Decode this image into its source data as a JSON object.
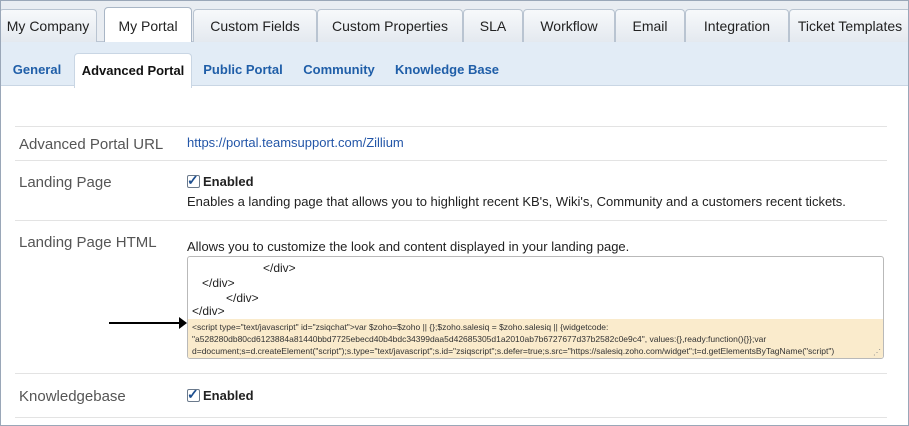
{
  "top_tabs": [
    {
      "label": "My Company"
    },
    {
      "label": "My Portal",
      "active": true
    },
    {
      "label": "Custom Fields"
    },
    {
      "label": "Custom Properties"
    },
    {
      "label": "SLA"
    },
    {
      "label": "Workflow"
    },
    {
      "label": "Email"
    },
    {
      "label": "Integration"
    },
    {
      "label": "Ticket Templates"
    }
  ],
  "sub_tabs": [
    {
      "label": "General"
    },
    {
      "label": "Advanced Portal",
      "active": true
    },
    {
      "label": "Public Portal"
    },
    {
      "label": "Community"
    },
    {
      "label": "Knowledge Base"
    }
  ],
  "rows": {
    "portal_url": {
      "label": "Advanced Portal URL",
      "value": "https://portal.teamsupport.com/Zillium"
    },
    "landing_page": {
      "label": "Landing Page",
      "checkbox_label": "Enabled",
      "checked": true,
      "description": "Enables a landing page that allows you to highlight recent KB's, Wiki's, Community and a customers recent tickets."
    },
    "landing_html": {
      "label": "Landing Page HTML",
      "description": "Allows you to customize the look and content displayed in your landing page.",
      "code_lines": [
        "</div>",
        "</div>",
        "</div>",
        "</div>"
      ],
      "script_lines": [
        "<script type=\"text/javascript\" id=\"zsiqchat\">var $zoho=$zoho || {};$zoho.salesiq = $zoho.salesiq || {widgetcode:",
        "\"a528280db80cd6123884a81440bbd7725ebecd40b4bdc34399daa5d42685305d1a2010ab7b6727677d37b2582c0e9c4\", values:{},ready:function(){}};var",
        "d=document;s=d.createElement(\"script\");s.type=\"text/javascript\";s.id=\"zsiqscript\";s.defer=true;s.src=\"https://salesiq.zoho.com/widget\";t=d.getElementsByTagName(\"script\")"
      ]
    },
    "knowledgebase": {
      "label": "Knowledgebase",
      "checkbox_label": "Enabled",
      "checked": true
    }
  },
  "colors": {
    "link": "#2356a8",
    "highlight": "#faebcc",
    "subtab_link": "#1f5ea8"
  },
  "icons": {
    "checkbox": "checkbox-checked-icon",
    "arrow": "arrow-right-icon"
  }
}
